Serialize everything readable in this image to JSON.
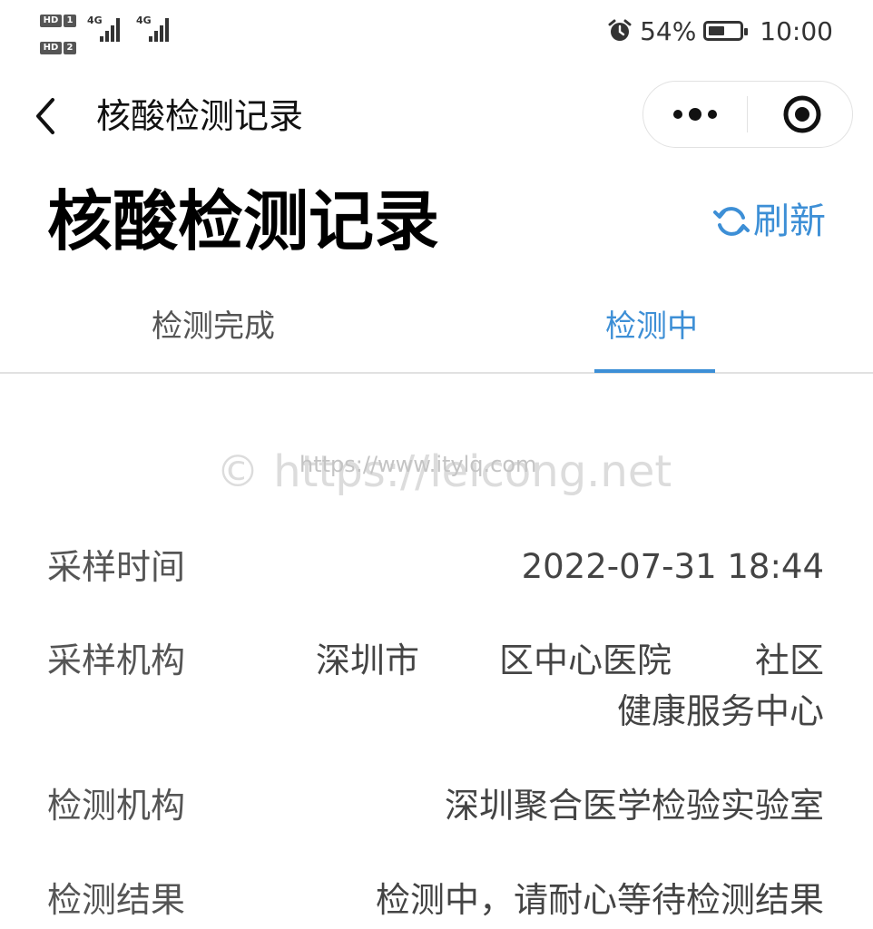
{
  "status_bar": {
    "sim1_badge": "HD",
    "sim1_num": "1",
    "sim2_badge": "HD",
    "sim2_num": "2",
    "net1": "4G",
    "net2": "4G",
    "battery_percent": "54%",
    "battery_level": 0.54,
    "time": "10:00",
    "icons": [
      "alarm-icon",
      "battery-icon",
      "signal-icon"
    ]
  },
  "nav": {
    "title": "核酸检测记录",
    "back_icon": "chevron-left-icon",
    "more_icon": "more-dots-icon",
    "close_icon": "target-close-icon"
  },
  "header": {
    "big_title": "核酸检测记录",
    "refresh_label": "刷新",
    "refresh_icon": "refresh-icon",
    "accent_color": "#3d8fd6"
  },
  "tabs": [
    {
      "label": "检测完成",
      "active": false
    },
    {
      "label": "检测中",
      "active": true
    }
  ],
  "watermark": {
    "large": "© https://leicong.net",
    "small": "https://www.itylq.com"
  },
  "record": {
    "sampling_time_label": "采样时间",
    "sampling_time_value": "2022-07-31 18:44",
    "sampling_org_label": "采样机构",
    "sampling_org_line1_a": "深圳市",
    "sampling_org_line1_b": "区中心医院",
    "sampling_org_line1_c": "社区",
    "sampling_org_line2": "健康服务中心",
    "testing_org_label": "检测机构",
    "testing_org_value": "深圳聚合医学检验实验室",
    "result_label": "检测结果",
    "result_value": "检测中，请耐心等待检测结果"
  }
}
